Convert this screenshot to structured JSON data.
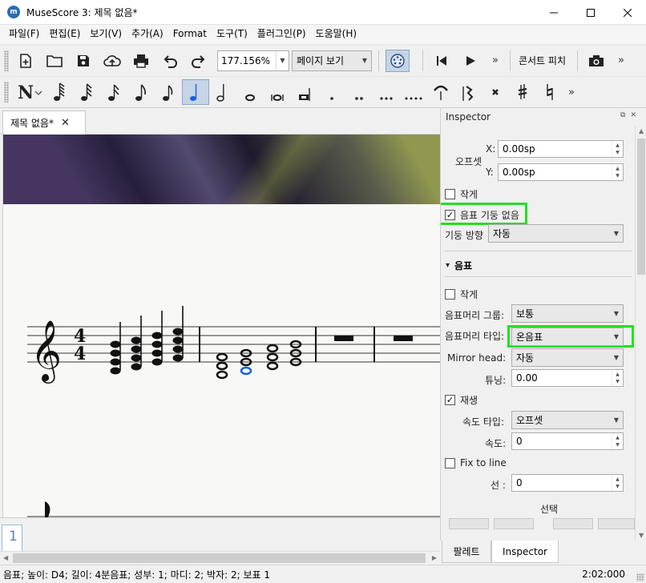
{
  "window": {
    "title": "MuseScore 3: 제목 없음*"
  },
  "menu": [
    "파일(F)",
    "편집(E)",
    "보기(V)",
    "추가(A)",
    "Format",
    "도구(T)",
    "플러그인(P)",
    "도움말(H)"
  ],
  "toolbar": {
    "zoom_value": "177.156%",
    "view_mode": "페이지 보기",
    "concert_pitch_label": "콘서트 피치",
    "overflow": "»"
  },
  "tabs": {
    "document": "제목 없음*"
  },
  "inspector": {
    "title": "Inspector",
    "offset_label": "오프셋",
    "x_label": "X:",
    "x_value": "0.00sp",
    "y_label": "Y:",
    "y_value": "0.00sp",
    "small_label_1": "작게",
    "no_stem_label": "음표 기둥 없음",
    "no_stem_checked": "✓",
    "stem_direction_label": "기둥 방향",
    "stem_direction_value": "자동",
    "note_section": "음표",
    "section_arrow": "▾",
    "small_label_2": "작게",
    "head_group_label": "음표머리 그룹:",
    "head_group_value": "보통",
    "head_type_label": "음표머리 타입:",
    "head_type_value": "온음표",
    "mirror_head_label": "Mirror head:",
    "mirror_head_value": "자동",
    "tuning_label": "튜닝:",
    "tuning_value": "0.00",
    "play_label": "재생",
    "play_checked": "✓",
    "velocity_type_label": "속도 타입:",
    "velocity_type_value": "오프셋",
    "velocity_label": "속도:",
    "velocity_value": "0",
    "fix_to_line_label": "Fix to line",
    "line_label": "선 :",
    "line_value": "0",
    "select_label": "선택"
  },
  "dock_tabs": [
    "팔레트",
    "Inspector"
  ],
  "navigator": {
    "page_number": "1"
  },
  "status": {
    "left": "음표; 높이: D4; 길이: 4분음표; 성부: 1;  마디: 2; 박자: 2; 보표 1",
    "right": "2:02:000"
  },
  "colors": {
    "highlight": "#22e022",
    "selected_note": "#1a5fd6",
    "accent": "#c5d4e6"
  }
}
